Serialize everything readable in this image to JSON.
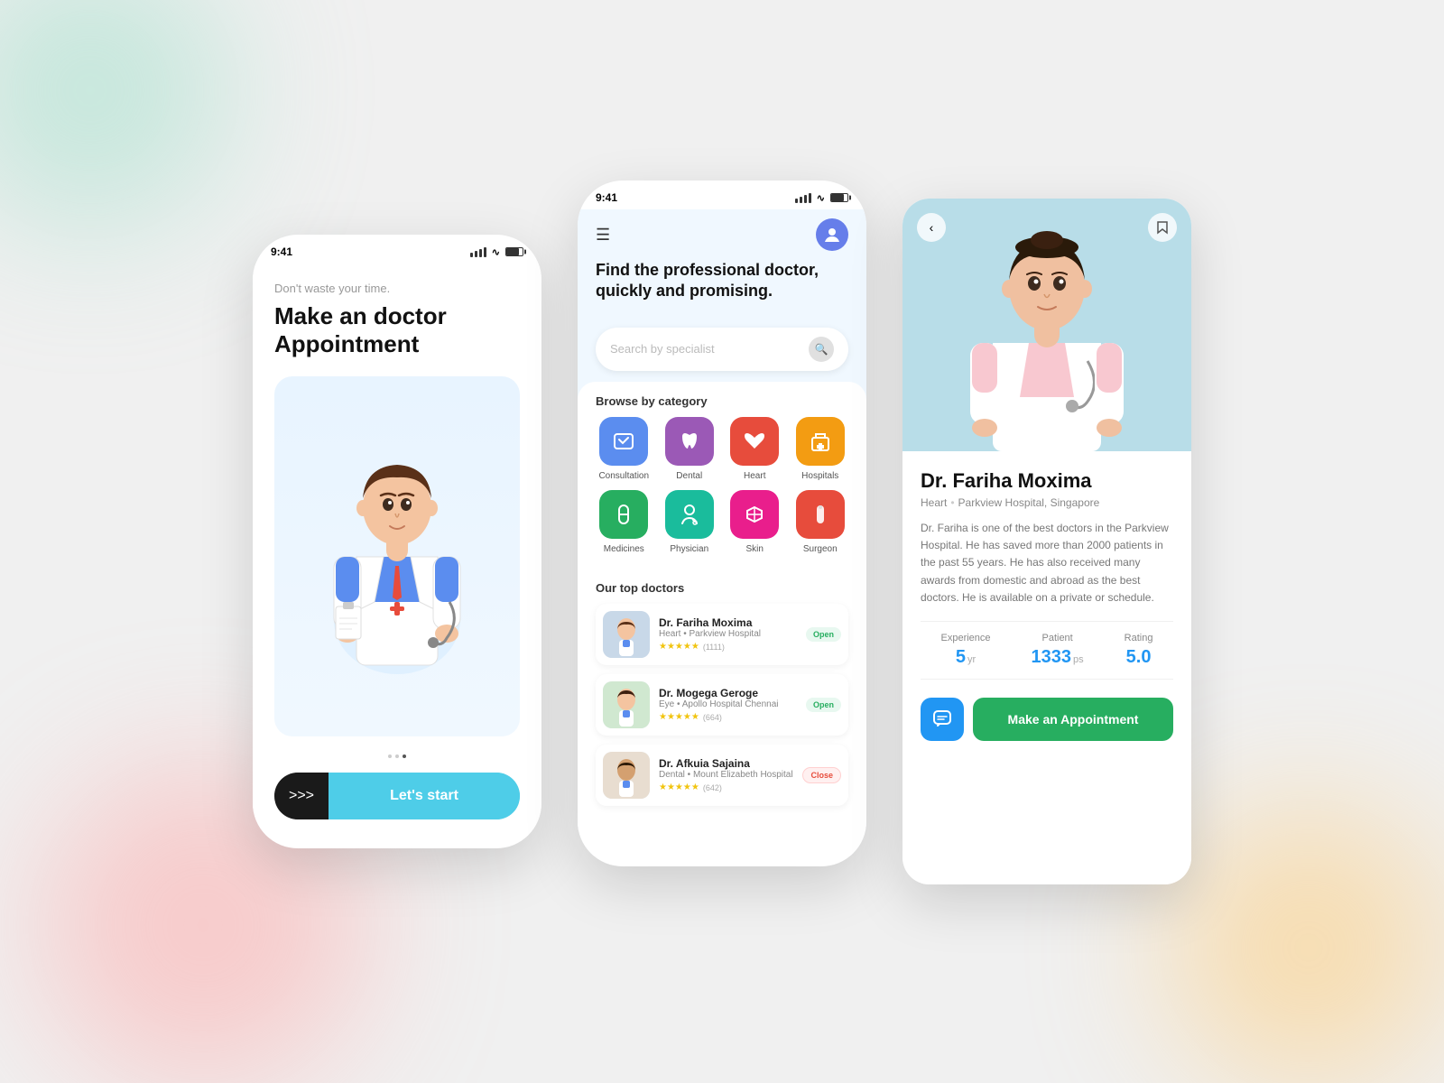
{
  "screen1": {
    "status_time": "9:41",
    "subtitle": "Don't waste your time.",
    "title": "Make an doctor Appointment",
    "dots": [
      false,
      false,
      true
    ],
    "btn_icon": ">>>",
    "btn_label": "Let's start"
  },
  "screen2": {
    "status_time": "9:41",
    "hero_title": "Find the professional doctor, quickly and promising.",
    "search_placeholder": "Search by specialist",
    "category_section_title": "Browse by category",
    "categories": [
      {
        "label": "Consultation",
        "icon": "🩺",
        "color": "cat-blue"
      },
      {
        "label": "Dental",
        "icon": "🦷",
        "color": "cat-purple"
      },
      {
        "label": "Heart",
        "icon": "❤️",
        "color": "cat-red"
      },
      {
        "label": "Hospitals",
        "icon": "🏥",
        "color": "cat-orange"
      },
      {
        "label": "Medicines",
        "icon": "💊",
        "color": "cat-green"
      },
      {
        "label": "Physician",
        "icon": "🧑‍⚕️",
        "color": "cat-teal"
      },
      {
        "label": "Skin",
        "icon": "✚",
        "color": "cat-pink"
      },
      {
        "label": "Surgeon",
        "icon": "💉",
        "color": "cat-coral"
      }
    ],
    "top_doctors_title": "Our top doctors",
    "doctors": [
      {
        "name": "Dr. Fariha Moxima",
        "specialty": "Heart",
        "hospital": "Parkview Hospital",
        "rating": "★★★★★",
        "count": "(1111)",
        "status": "Open",
        "status_type": "open"
      },
      {
        "name": "Dr. Mogega Geroge",
        "specialty": "Eye",
        "hospital": "Apollo Hospital Chennai",
        "rating": "★★★★★",
        "count": "(664)",
        "status": "Open",
        "status_type": "open"
      },
      {
        "name": "Dr. Afkuia Sajaina",
        "specialty": "Dental",
        "hospital": "Mount Elizabeth Hospital",
        "rating": "★★★★★",
        "count": "(642)",
        "status": "Close",
        "status_type": "close"
      }
    ]
  },
  "screen3": {
    "back_icon": "‹",
    "bookmark_icon": "🔖",
    "doctor_name": "Dr. Fariha Moxima",
    "doctor_specialty": "Heart",
    "doctor_hospital": "Parkview Hospital, Singapore",
    "bio": "Dr. Fariha is one of the best doctors in the Parkview Hospital. He has saved more than 2000 patients in the past 55 years. He has also received many awards from domestic and abroad as the best doctors. He is available on a private or schedule.",
    "stats": [
      {
        "label": "Experience",
        "value": "5",
        "unit": "yr"
      },
      {
        "label": "Patient",
        "value": "1333",
        "unit": "ps"
      },
      {
        "label": "Rating",
        "value": "5.0",
        "unit": ""
      }
    ],
    "make_appointment_label": "Make an Appointment",
    "chat_icon": "💬"
  }
}
